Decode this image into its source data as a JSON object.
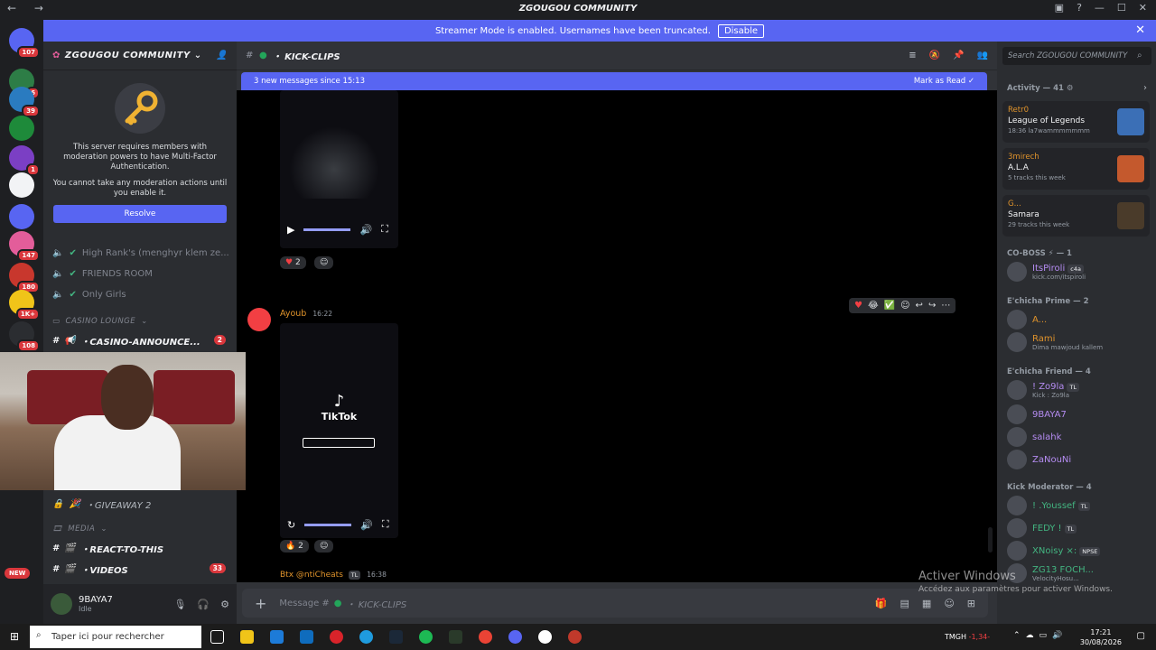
{
  "window": {
    "title": "ZGOUGOU COMMUNITY"
  },
  "banner": {
    "text": "Streamer Mode is enabled. Usernames have been truncated.",
    "disable_label": "Disable"
  },
  "guilds": [
    {
      "badge": "107",
      "color": "#5865f2"
    },
    {
      "badge": "6",
      "color": "#2d7d46"
    },
    {
      "badge": "39",
      "color": "#2a7bc0"
    },
    {
      "badge": "",
      "color": "#1e8a3a"
    },
    {
      "badge": "1",
      "color": "#7b3fc4"
    },
    {
      "badge": "",
      "color": "#f2f3f5"
    },
    {
      "badge": "",
      "color": "#5865f2"
    },
    {
      "badge": "147",
      "color": "#e35d9a"
    },
    {
      "badge": "180",
      "color": "#c8372d"
    },
    {
      "badge": "1K+",
      "color": "#f0c419"
    },
    {
      "badge": "108",
      "color": "#2b2d31"
    }
  ],
  "sidebar": {
    "server_name": "ZGOUGOU COMMUNITY",
    "mfa_text_1": "This server requires members with moderation powers to have Multi-Factor Authentication.",
    "mfa_text_2": "You cannot take any moderation actions until you enable it.",
    "resolve_label": "Resolve",
    "channels": [
      {
        "name": "High Rank's (menghyr klem ze...",
        "type": "voice"
      },
      {
        "name": "FRIENDS ROOM",
        "type": "voice"
      },
      {
        "name": "Only Girls",
        "type": "voice"
      }
    ],
    "category_casino": "CASINO LOUNGE",
    "casino_channel": "・CASINO-ANNOUNCE...",
    "casino_badge": "2",
    "giveaway": "・GIVEAWAY 2",
    "category_media": "MEDIA",
    "react_channel": "・REACT-TO-THIS",
    "videos_channel": "・VIDEOS",
    "videos_badge": "33",
    "new_badge": "NEW"
  },
  "user": {
    "name": "9BAYA7",
    "status": "Idle"
  },
  "channel": {
    "name": "・ KICK-CLIPS",
    "new_messages": "3 new messages since 15:13",
    "mark_read": "Mark as Read",
    "composer_placeholder": "Message #",
    "composer_channel": "・ KICK-CLIPS"
  },
  "messages": [
    {
      "reaction_count": "2"
    },
    {
      "author": "Ayoub",
      "time": "16:22",
      "video_label": "TikTok",
      "reaction_count": "2"
    },
    {
      "author": "Btx @ntiCheats",
      "tag": "TL",
      "time": "16:38"
    }
  ],
  "members": {
    "search_placeholder": "Search ZGOUGOU COMMUNITY",
    "activity_header": "Activity — 41",
    "activities": [
      {
        "user": "Retr0",
        "title": "League of Legends",
        "detail": "18:36",
        "detail2": "la7wammmmmmm",
        "color": "#3b6fb6"
      },
      {
        "user": "3mirech",
        "title": "A.L.A",
        "detail": "5 tracks this week",
        "color": "#c4592d"
      },
      {
        "user": "G...",
        "title": "Samara",
        "detail": "29 tracks this week",
        "color": "#4a3b2a"
      }
    ],
    "groups": [
      {
        "header": "CO-BOSS ⚡ — 1",
        "list": [
          {
            "name": "ItsPiroli",
            "tag": "c4a",
            "sub": "kick.com/itspiroli",
            "color": "#b58cf2"
          }
        ]
      },
      {
        "header": "E'chicha Prime — 2",
        "list": [
          {
            "name": "A...",
            "sub": "",
            "color": "#e0932b"
          },
          {
            "name": "Rami",
            "sub": "Dima mawjoud kallem",
            "color": "#e0932b"
          }
        ]
      },
      {
        "header": "E'chicha Friend — 4",
        "list": [
          {
            "name": "! Zo9la",
            "tag": "TL",
            "sub": "Kick : Zo9la",
            "color": "#b58cf2"
          },
          {
            "name": "9BAYA7",
            "sub": "",
            "color": "#b58cf2"
          },
          {
            "name": "salahk",
            "sub": "",
            "color": "#b58cf2"
          },
          {
            "name": "ZaNouNi",
            "sub": "",
            "color": "#b58cf2"
          }
        ]
      },
      {
        "header": "Kick Moderator — 4",
        "list": [
          {
            "name": "! .Youssef",
            "tag": "TL",
            "sub": "",
            "color": "#43b581"
          },
          {
            "name": "FEDY !",
            "tag": "TL",
            "sub": "",
            "color": "#43b581"
          },
          {
            "name": "XNoisy ×:",
            "tag": "NPSE",
            "sub": "",
            "color": "#43b581"
          },
          {
            "name": "ZG13 FOCH...",
            "sub": "VelocityHosu...",
            "color": "#43b581"
          }
        ]
      }
    ]
  },
  "watermark": {
    "title": "Activer Windows",
    "sub": "Accédez aux paramètres pour activer Windows."
  },
  "taskbar": {
    "search": "Taper ici pour rechercher",
    "ticker": "TMGH",
    "ticker_val": "-1,34-",
    "time": "17:21",
    "date": "30/08/2026"
  }
}
